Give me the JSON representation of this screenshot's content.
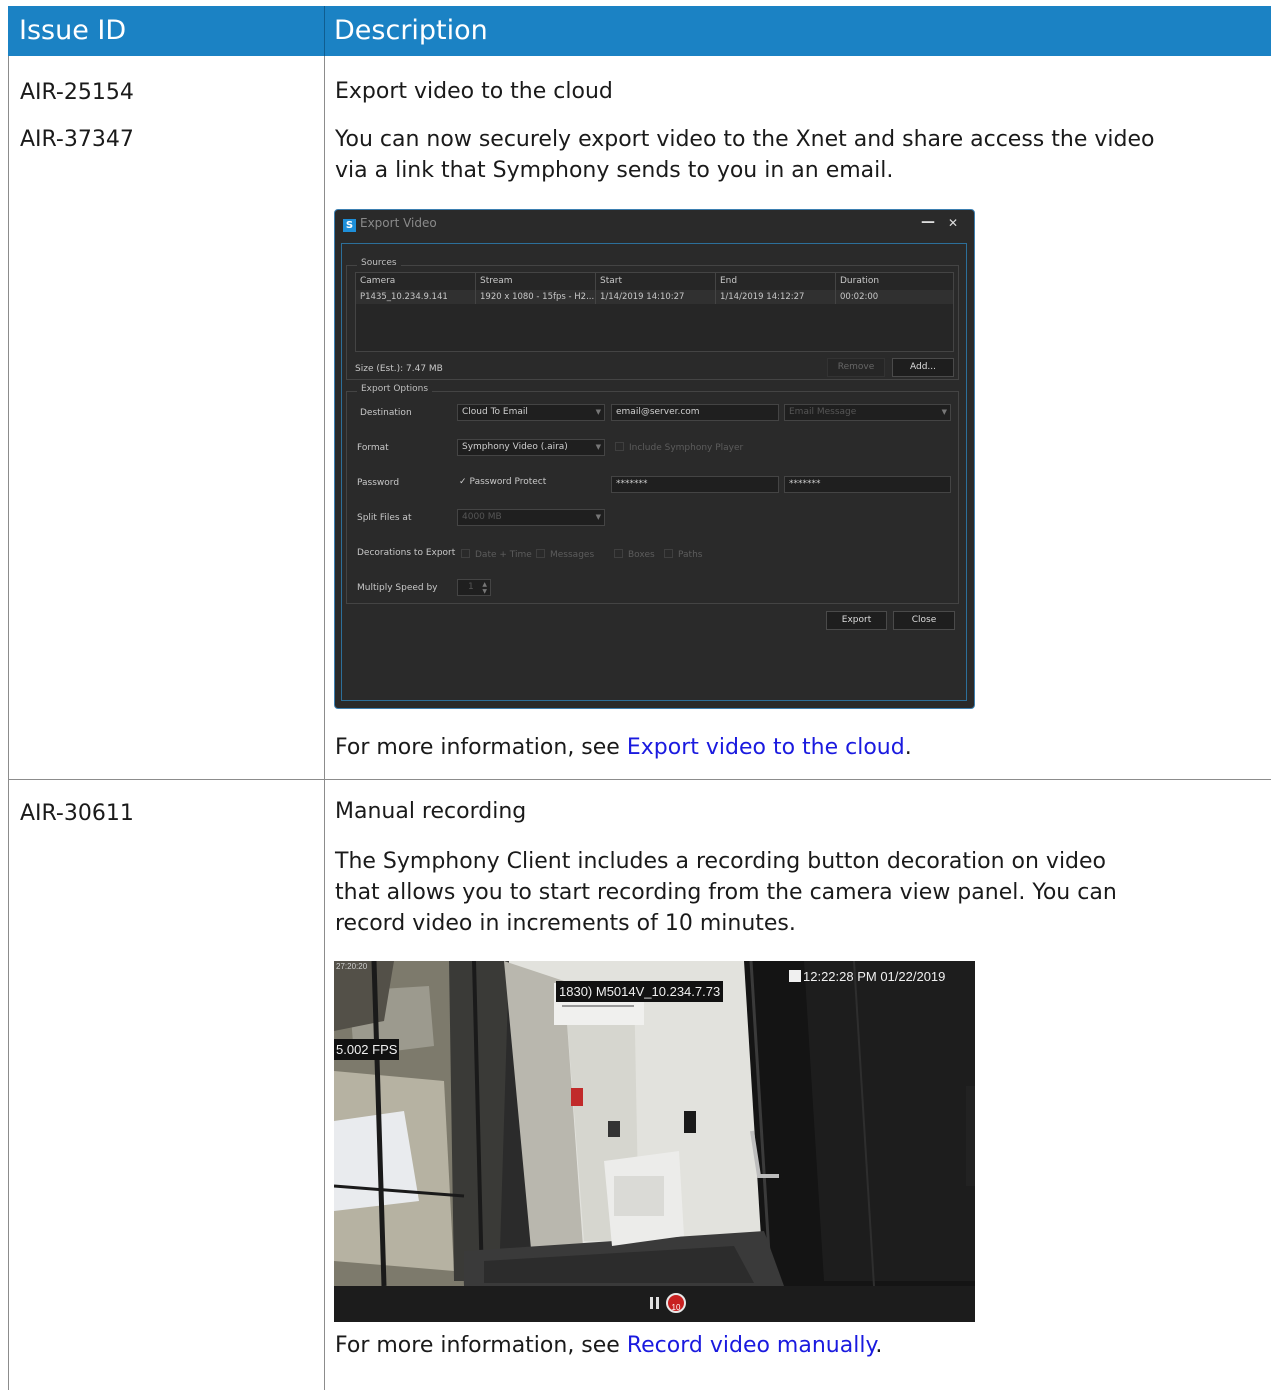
{
  "table": {
    "headers": [
      "Issue ID",
      "Description"
    ],
    "rows": [
      {
        "ids": [
          "AIR-25154",
          "AIR-37347"
        ],
        "title": "Export video to the cloud",
        "body_lines": [
          "You can now securely export video to the Xnet and share access the video",
          "via a link that Symphony sends to you in an email."
        ],
        "more_prefix": "For more information, see ",
        "more_link": "Export video to the cloud",
        "more_suffix": "."
      },
      {
        "ids": [
          "AIR-30611"
        ],
        "title": "Manual recording",
        "body_lines": [
          "The Symphony Client includes a recording button decoration on video",
          "that allows you to start recording from the camera view panel. You can",
          "record video in increments of 10 minutes."
        ],
        "more_prefix": "For more information, see ",
        "more_link": "Record video manually",
        "more_suffix": "."
      }
    ]
  },
  "export_dialog": {
    "logo": "S",
    "title": "Export Video",
    "sources_label": "Sources",
    "columns": [
      "Camera",
      "Stream",
      "Start",
      "End",
      "Duration"
    ],
    "row": [
      "P1435_10.234.9.141",
      "1920 x 1080 - 15fps - H2...",
      "1/14/2019 14:10:27",
      "1/14/2019 14:12:27",
      "00:02:00"
    ],
    "size_label": "Size (Est.): 7.47 MB",
    "remove_label": "Remove",
    "add_label": "Add...",
    "options_label": "Export Options",
    "destination_label": "Destination",
    "destination_value": "Cloud To Email",
    "email_value": "email@server.com",
    "email_message_placeholder": "Email Message",
    "format_label": "Format",
    "format_value": "Symphony Video (.aira)",
    "include_player_label": "Include Symphony Player",
    "password_label": "Password",
    "password_protect_label": "Password Protect",
    "password_value": "*******",
    "password_confirm_value": "*******",
    "split_label": "Split Files at",
    "split_value": "4000 MB",
    "decorations_label": "Decorations to Export",
    "decorations": [
      "Date + Time",
      "Messages",
      "Boxes",
      "Paths"
    ],
    "multiply_label": "Multiply Speed by",
    "multiply_value": "1",
    "export_label": "Export",
    "close_label": "Close"
  },
  "camera_view": {
    "corner_time": "27:20:20",
    "camera_name": "1830) M5014V_10.234.7.73",
    "timestamp": "12:22:28 PM 01/22/2019",
    "fps": "5.002 FPS",
    "record_increment": "10",
    "colors": {
      "record": "#c82020"
    }
  }
}
